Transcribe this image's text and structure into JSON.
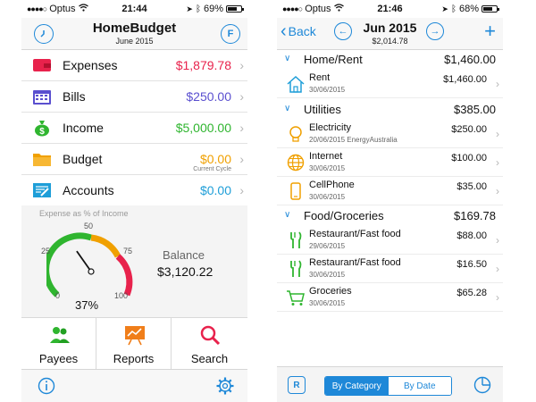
{
  "left": {
    "status": {
      "carrier": "Optus",
      "time": "21:44",
      "battery": "69%",
      "battery_level": 0.69
    },
    "header": {
      "title": "HomeBudget",
      "subtitle": "June 2015",
      "right_button": "F"
    },
    "menu": [
      {
        "label": "Expenses",
        "value": "$1,879.78",
        "color": "#e8224c",
        "icon": "wallet-icon"
      },
      {
        "label": "Bills",
        "value": "$250.00",
        "color": "#5a4fcf",
        "icon": "calendar-icon"
      },
      {
        "label": "Income",
        "value": "$5,000.00",
        "color": "#2fb52f",
        "icon": "money-bag-icon"
      },
      {
        "label": "Budget",
        "value": "$0.00",
        "color": "#f0a000",
        "icon": "folder-icon",
        "note": "Current Cycle"
      },
      {
        "label": "Accounts",
        "value": "$0.00",
        "color": "#1e9ed8",
        "icon": "accounts-icon"
      }
    ],
    "gauge": {
      "caption": "Expense as % of Income",
      "ticks": [
        "0",
        "25",
        "50",
        "75",
        "100"
      ],
      "percent_label": "37%",
      "percent_value": 37
    },
    "balance": {
      "label": "Balance",
      "value": "$3,120.22"
    },
    "tiles": [
      {
        "label": "Payees",
        "icon": "people-icon"
      },
      {
        "label": "Reports",
        "icon": "chart-board-icon"
      },
      {
        "label": "Search",
        "icon": "magnifier-icon"
      }
    ],
    "tabbar": {
      "left_icon": "info-icon",
      "right_icon": "settings-gear-icon"
    }
  },
  "right": {
    "status": {
      "carrier": "Optus",
      "time": "21:46",
      "battery": "68%",
      "battery_level": 0.68
    },
    "header": {
      "back": "Back",
      "title": "Jun 2015",
      "subtitle": "$2,014.78"
    },
    "categories": [
      {
        "name": "Home/Rent",
        "total": "$1,460.00",
        "items": [
          {
            "name": "Rent",
            "date": "30/06/2015",
            "amount": "$1,460.00",
            "icon": "house-icon"
          }
        ]
      },
      {
        "name": "Utilities",
        "total": "$385.00",
        "items": [
          {
            "name": "Electricity",
            "date": "20/06/2015 EnergyAustralia",
            "amount": "$250.00",
            "icon": "lightbulb-icon"
          },
          {
            "name": "Internet",
            "date": "30/06/2015",
            "amount": "$100.00",
            "icon": "globe-icon"
          },
          {
            "name": "CellPhone",
            "date": "30/06/2015",
            "amount": "$35.00",
            "icon": "phone-icon"
          }
        ]
      },
      {
        "name": "Food/Groceries",
        "total": "$169.78",
        "items": [
          {
            "name": "Restaurant/Fast food",
            "date": "29/06/2015",
            "amount": "$88.00",
            "icon": "fork-knife-icon"
          },
          {
            "name": "Restaurant/Fast food",
            "date": "30/06/2015",
            "amount": "$16.50",
            "icon": "fork-knife-icon"
          },
          {
            "name": "Groceries",
            "date": "30/06/2015",
            "amount": "$65.28",
            "icon": "cart-icon"
          }
        ]
      }
    ],
    "tabbar": {
      "r_button": "R",
      "seg_on": "By Category",
      "seg_off": "By Date"
    }
  }
}
